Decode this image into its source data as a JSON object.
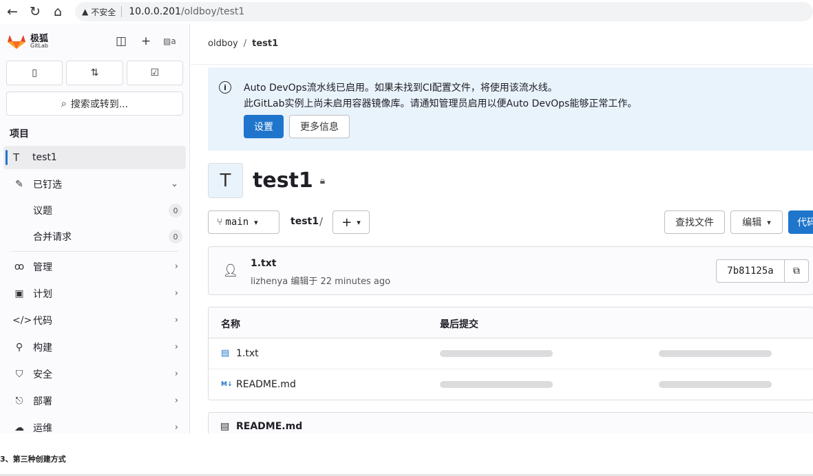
{
  "browser": {
    "security_warning": "不安全",
    "url_host": "10.0.0.201",
    "url_path": "/oldboy/test1"
  },
  "sidebar": {
    "brand_cn": "极狐",
    "brand_en": "GitLab",
    "avatar_alt": "a",
    "search_label": "搜索或转到...",
    "section_title": "项目",
    "project": {
      "badge": "T",
      "name": "test1"
    },
    "pinned": {
      "label": "已钉选",
      "items": [
        {
          "label": "议题",
          "count": "0"
        },
        {
          "label": "合并请求",
          "count": "0"
        }
      ]
    },
    "nav_items": [
      {
        "label": "管理"
      },
      {
        "label": "计划"
      },
      {
        "label": "代码"
      },
      {
        "label": "构建"
      },
      {
        "label": "安全"
      },
      {
        "label": "部署"
      },
      {
        "label": "运维"
      }
    ]
  },
  "breadcrumb": {
    "group": "oldboy",
    "project": "test1"
  },
  "alert": {
    "line1": "Auto DevOps流水线已启用。如果未找到CI配置文件，将使用该流水线。",
    "line2": "此GitLab实例上尚未启用容器镜像库。请通知管理员启用以便Auto DevOps能够正常工作。",
    "primary_button": "设置",
    "secondary_button": "更多信息"
  },
  "project_header": {
    "avatar_letter": "T",
    "title": "test1"
  },
  "repo_toolbar": {
    "branch": "main",
    "path_root": "test1",
    "path_sep": "/",
    "find_file": "查找文件",
    "edit": "编辑",
    "code": "代码"
  },
  "last_commit": {
    "title": "1.txt",
    "meta": "lizhenya 编辑于 22 minutes ago",
    "sha": "7b81125a"
  },
  "file_table": {
    "col_name": "名称",
    "col_last_commit": "最后提交",
    "rows": [
      {
        "name": "1.txt"
      },
      {
        "name": "README.md"
      }
    ]
  },
  "readme": {
    "filename": "README.md"
  },
  "doc": {
    "heading": "3、第三种创建方式"
  }
}
